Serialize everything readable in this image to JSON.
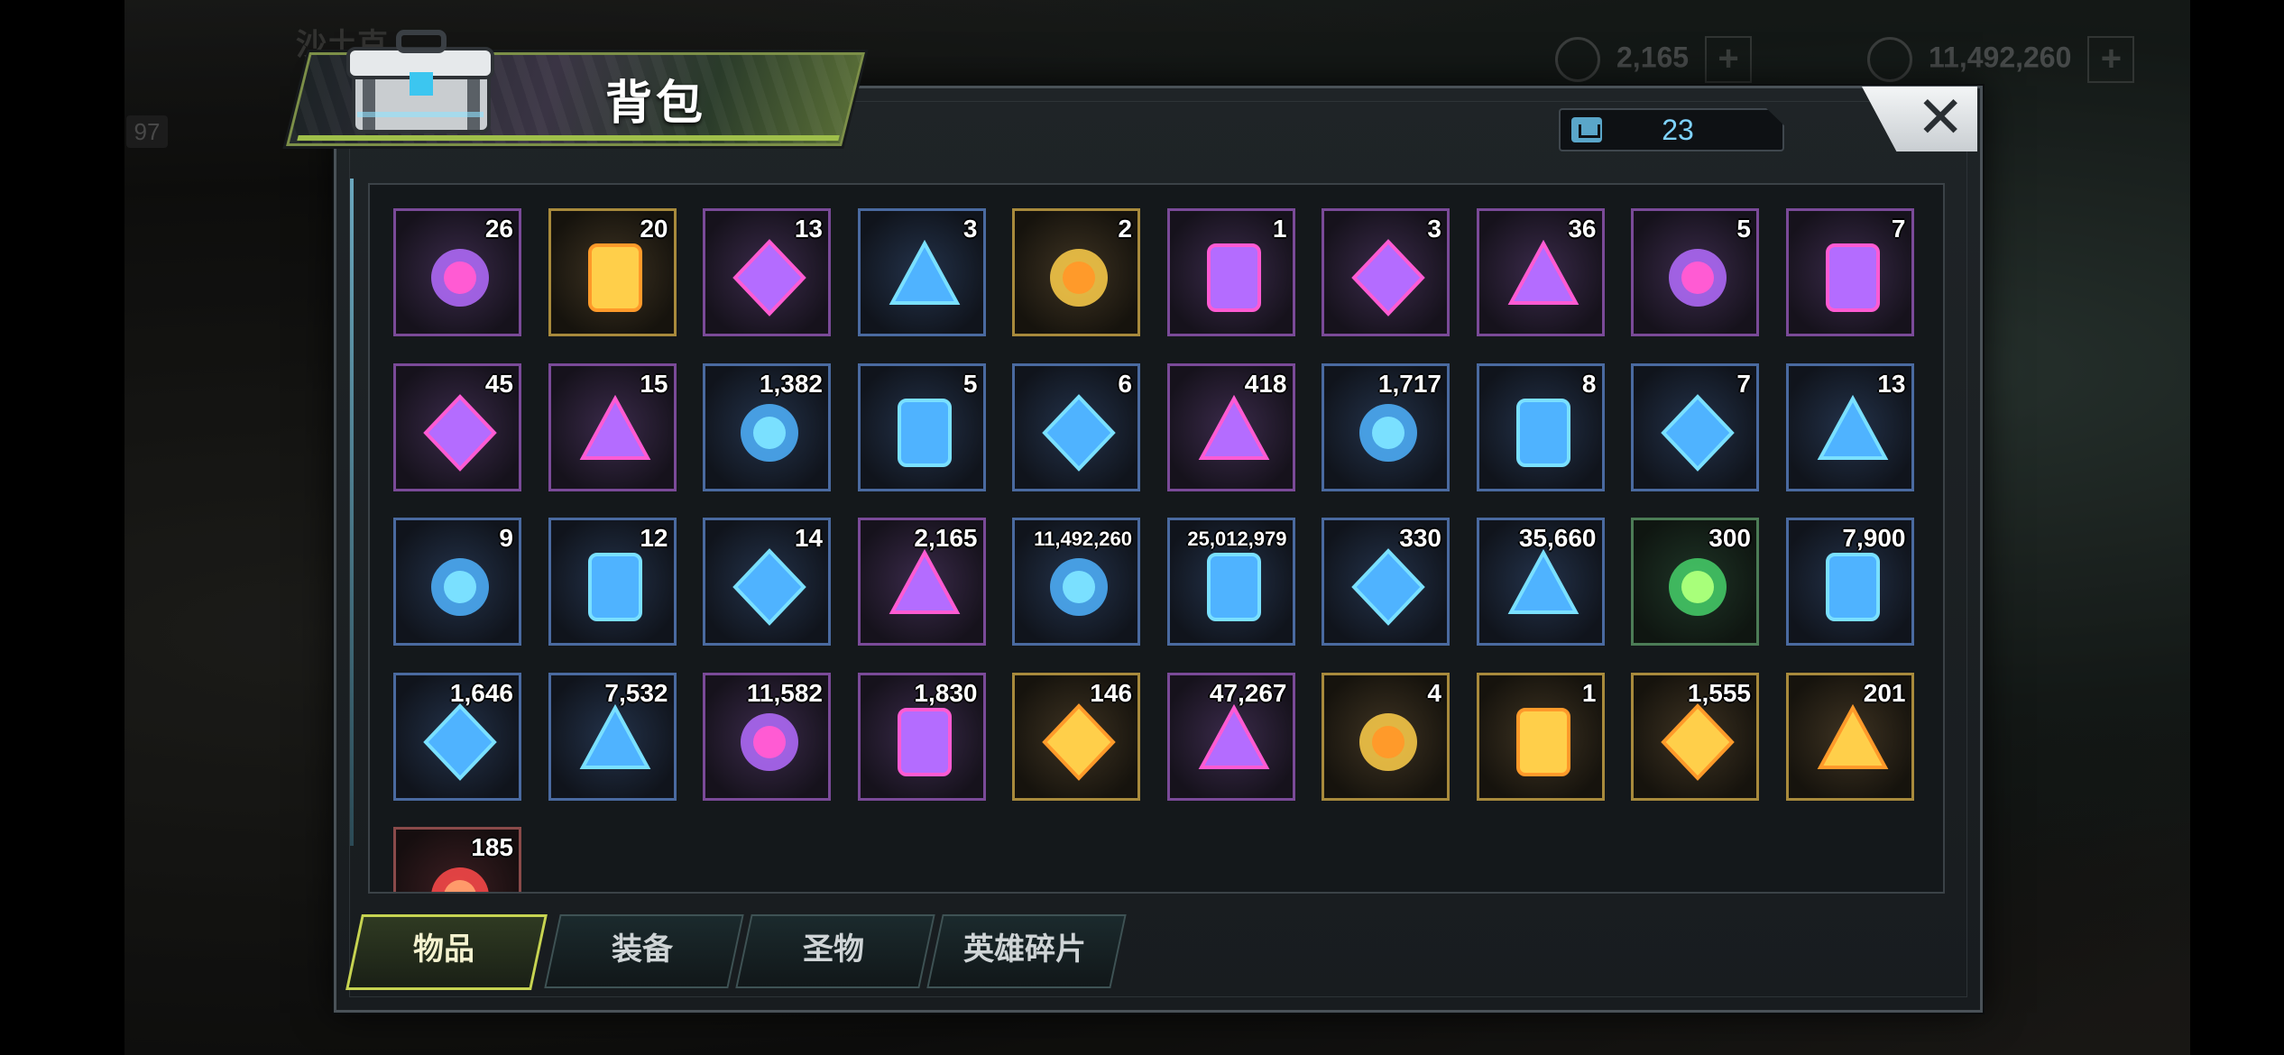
{
  "background": {
    "title_hint": "沙土克",
    "level": "97",
    "resources": [
      {
        "icon": "gem-icon",
        "value": "2,165"
      },
      {
        "icon": "gold-coin-icon",
        "value": "11,492,260"
      }
    ]
  },
  "header": {
    "title": "背包",
    "capacity_icon": "bag-icon",
    "capacity": "23",
    "close_label": "✕"
  },
  "colors": {
    "banner_accent": "#9fbf4a",
    "active_tab_border": "#c7d451",
    "capacity_text": "#7fd3ff"
  },
  "items": [
    {
      "icon": "speed-up-hourglass-icon",
      "count": "26",
      "rarity": "purple"
    },
    {
      "icon": "gold-24h-card-icon",
      "count": "20",
      "rarity": "gold"
    },
    {
      "icon": "speedup-12h-card-icon",
      "count": "13",
      "rarity": "purple"
    },
    {
      "icon": "speedup-4h-card-icon",
      "count": "3",
      "rarity": "blue"
    },
    {
      "icon": "red-bottlecap-icon",
      "count": "2",
      "rarity": "gold"
    },
    {
      "icon": "metal-crate-icon",
      "count": "1",
      "rarity": "purple"
    },
    {
      "icon": "fish-icon",
      "count": "3",
      "rarity": "purple"
    },
    {
      "icon": "film-reel-icon",
      "count": "36",
      "rarity": "purple"
    },
    {
      "icon": "purple-bottlecap-icon",
      "count": "5",
      "rarity": "purple"
    },
    {
      "icon": "casino-chip-spade-icon",
      "count": "7",
      "rarity": "purple"
    },
    {
      "icon": "police-badge-icon",
      "count": "45",
      "rarity": "purple"
    },
    {
      "icon": "neon-sword-icon",
      "count": "15",
      "rarity": "purple"
    },
    {
      "icon": "cinema-ticket-icon",
      "count": "1,382",
      "rarity": "blue"
    },
    {
      "icon": "blue-token-icon",
      "count": "5",
      "rarity": "blue"
    },
    {
      "icon": "blue-bottlecap-icon",
      "count": "6",
      "rarity": "blue"
    },
    {
      "icon": "red-casino-chip-icon",
      "count": "418",
      "rarity": "purple"
    },
    {
      "icon": "bullet-icon",
      "count": "1,717",
      "rarity": "blue"
    },
    {
      "icon": "boots-blueprint-icon",
      "count": "8",
      "rarity": "blue"
    },
    {
      "icon": "revolver-blueprint-icon",
      "count": "7",
      "rarity": "blue"
    },
    {
      "icon": "swords-blueprint-icon",
      "count": "13",
      "rarity": "blue"
    },
    {
      "icon": "hat-blueprint-icon",
      "count": "9",
      "rarity": "blue"
    },
    {
      "icon": "shirt-blueprint-icon",
      "count": "12",
      "rarity": "blue"
    },
    {
      "icon": "pants-blueprint-icon",
      "count": "14",
      "rarity": "blue"
    },
    {
      "icon": "purple-gem-icon",
      "count": "2,165",
      "rarity": "purple"
    },
    {
      "icon": "gold-coins-icon",
      "count": "11,492,260",
      "rarity": "blue"
    },
    {
      "icon": "green-battery-icon",
      "count": "25,012,979",
      "rarity": "blue"
    },
    {
      "icon": "purple-orb-icon",
      "count": "330",
      "rarity": "blue"
    },
    {
      "icon": "gear-icon",
      "count": "35,660",
      "rarity": "blue"
    },
    {
      "icon": "red-network-orb-icon",
      "count": "300",
      "rarity": "green"
    },
    {
      "icon": "eye-card-icon",
      "count": "7,900",
      "rarity": "blue"
    },
    {
      "icon": "white-triangle-shard-icon",
      "count": "1,646",
      "rarity": "blue"
    },
    {
      "icon": "golden-fist-icon",
      "count": "7,532",
      "rarity": "blue"
    },
    {
      "icon": "puzzle-piece-icon",
      "count": "11,582",
      "rarity": "purple"
    },
    {
      "icon": "red-ship-emblem-icon",
      "count": "1,830",
      "rarity": "purple"
    },
    {
      "icon": "gold-ship-emblem-icon",
      "count": "146",
      "rarity": "gold"
    },
    {
      "icon": "biohazard-crystal-icon",
      "count": "47,267",
      "rarity": "purple"
    },
    {
      "icon": "orange-triangle-crystal-icon",
      "count": "4",
      "rarity": "gold"
    },
    {
      "icon": "propeller-medal-icon",
      "count": "1",
      "rarity": "gold"
    },
    {
      "icon": "red-rock-crystal-icon",
      "count": "1,555",
      "rarity": "gold"
    },
    {
      "icon": "gold-coin-stack-icon",
      "count": "201",
      "rarity": "gold"
    },
    {
      "icon": "red-target-icon",
      "count": "185",
      "rarity": "red"
    }
  ],
  "tabs": [
    {
      "label": "物品",
      "active": true
    },
    {
      "label": "装备",
      "active": false
    },
    {
      "label": "圣物",
      "active": false
    },
    {
      "label": "英雄碎片",
      "active": false
    }
  ]
}
